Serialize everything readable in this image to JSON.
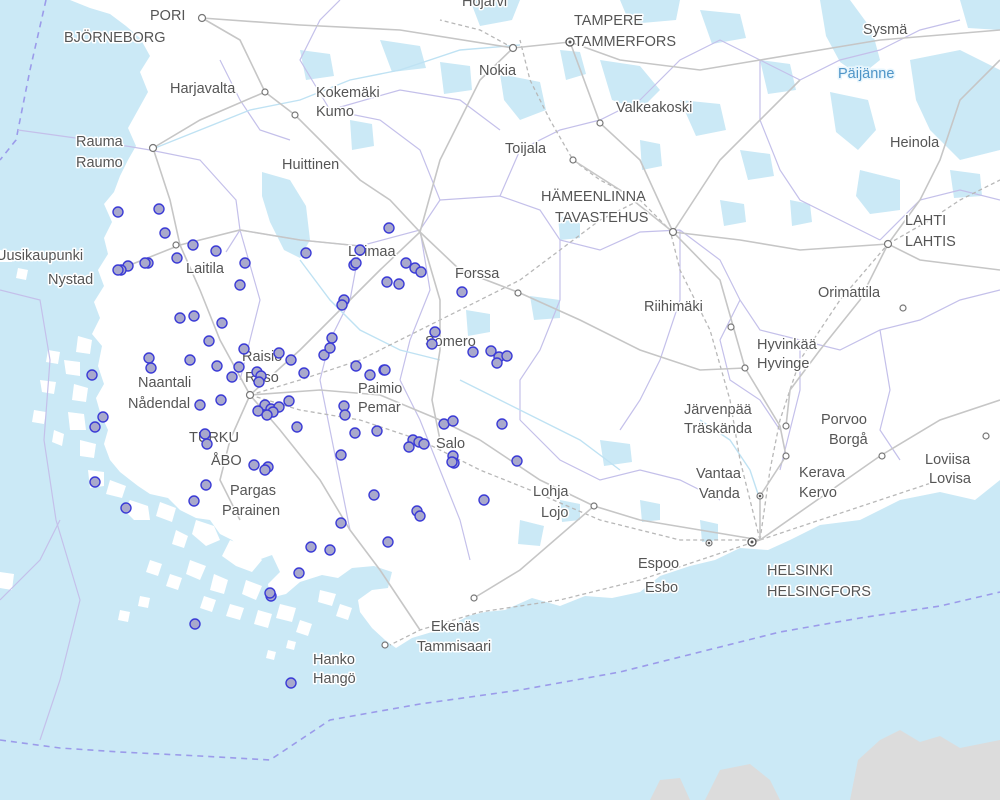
{
  "map": {
    "colors": {
      "sea": "#cbe9f6",
      "land": "#ffffff",
      "lake": "#cbe9f6",
      "road": "#c9c9c9",
      "railway": "#b3b3b3",
      "municipal_border": "#c4c0ea",
      "sea_border": "#9b9bea",
      "foreign_land": "#dcdcdc",
      "marker_fill": "#a9a9cc",
      "marker_stroke": "#3b3bd6"
    },
    "place_labels": [
      "PORI",
      "BJÖRNEBORG",
      "Harjavalta",
      "Kokemäki",
      "Kumo",
      "Rauma",
      "Raumo",
      "Huittinen",
      "Uusikaupunki",
      "Nystad",
      "Laitila",
      "Loimaa",
      "Forssa",
      "Raisio",
      "Reso",
      "Naantali",
      "Nådendal",
      "TURKU",
      "ÅBO",
      "Pargas",
      "Parainen",
      "Paimio",
      "Pemar",
      "Somero",
      "Salo",
      "Lohja",
      "Lojo",
      "Hanko",
      "Hangö",
      "Ekenäs",
      "Tammisaari",
      "Nokia",
      "TAMPERE",
      "TAMMERFORS",
      "Valkeakoski",
      "Toijala",
      "HÄMEENLINNA",
      "TAVASTEHUS",
      "Riihimäki",
      "Hyvinkää",
      "Hyvinge",
      "Järvenpää",
      "Träskända",
      "Vantaa",
      "Vanda",
      "Kerava",
      "Kervo",
      "Espoo",
      "Esbo",
      "HELSINKI",
      "HELSINGFORS",
      "Porvoo",
      "Borgå",
      "Loviisa",
      "Lovisa",
      "Orimattila",
      "LAHTI",
      "LAHTIS",
      "Heinola",
      "Sysmä",
      "Hojärvi"
    ],
    "water_labels": [
      "Päijänne"
    ],
    "markers": {
      "count": 103,
      "icon": "circle-marker-icon"
    }
  }
}
